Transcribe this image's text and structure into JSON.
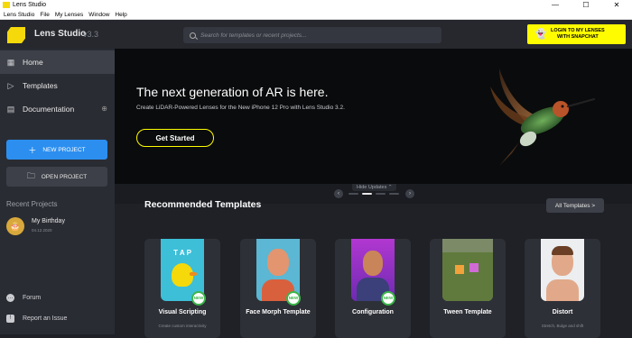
{
  "window": {
    "title": "Lens Studio",
    "controls": [
      "—",
      "☐",
      "✕"
    ]
  },
  "menu": [
    "Lens Studio",
    "File",
    "My Lenses",
    "Window",
    "Help"
  ],
  "header": {
    "brand": "Lens Studio",
    "version": "v3.3",
    "search_placeholder": "Search for templates or recent projects...",
    "login_line1": "LOGIN TO MY LENSES",
    "login_line2": "WITH SNAPCHAT"
  },
  "sidebar": {
    "items": [
      {
        "label": "Home",
        "icon": "home-icon",
        "active": true
      },
      {
        "label": "Templates",
        "icon": "templates-icon"
      },
      {
        "label": "Documentation",
        "icon": "documentation-icon"
      }
    ],
    "new_project": "NEW PROJECT",
    "open_project": "OPEN PROJECT",
    "recent_heading": "Recent Projects",
    "recent": [
      {
        "name": "My Birthday",
        "date": "04.12.2020"
      }
    ],
    "footer": [
      {
        "label": "Forum"
      },
      {
        "label": "Report an Issue"
      }
    ]
  },
  "hero": {
    "title": "The next generation of AR is here.",
    "subtitle": "Create LiDAR-Powered Lenses for the New iPhone 12 Pro with Lens Studio 3.2.",
    "cta": "Get Started"
  },
  "pager": {
    "hide_label": "Hide Updates",
    "active_index": 1,
    "count": 4
  },
  "recommended": {
    "title": "Recommended Templates",
    "all_button": "All Templates >",
    "cards": [
      {
        "name": "Visual Scripting",
        "desc": "Create custom interactivity",
        "badge": "NEW",
        "overlay": "T A P"
      },
      {
        "name": "Face Morph Template",
        "desc": "",
        "badge": "NEW"
      },
      {
        "name": "Configuration",
        "desc": "",
        "badge": "NEW"
      },
      {
        "name": "Tween Template",
        "desc": "",
        "badge": ""
      },
      {
        "name": "Distort",
        "desc": "Stretch, Bulge and shift",
        "badge": ""
      }
    ]
  },
  "colors": {
    "accent": "#fffc00",
    "primary_button": "#2c8ff0",
    "new_badge": "#3bb54a"
  }
}
